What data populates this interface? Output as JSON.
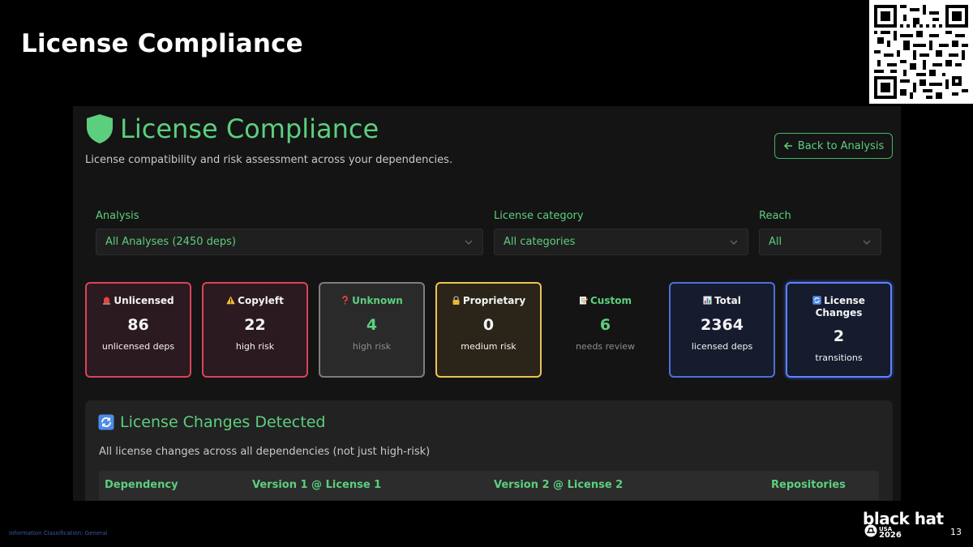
{
  "slide": {
    "title": "License Compliance",
    "classification": "Information Classification: General",
    "page_number": "13",
    "logo_text": "black hat",
    "logo_region": "USA",
    "logo_year": "2026"
  },
  "app": {
    "title": "License Compliance",
    "subtitle": "License compatibility and risk assessment across your dependencies.",
    "back_button": "Back to Analysis",
    "accent_color": "#5ccf7e",
    "filters": {
      "analysis": {
        "label": "Analysis",
        "value": "All Analyses (2450 deps)"
      },
      "category": {
        "label": "License category",
        "value": "All categories"
      },
      "reach": {
        "label": "Reach",
        "value": "All"
      }
    },
    "cards": [
      {
        "icon": "siren-icon",
        "title": "Unlicensed",
        "value": "86",
        "subtitle": "unlicensed deps",
        "color": "#d9445a"
      },
      {
        "icon": "warning-icon",
        "title": "Copyleft",
        "value": "22",
        "subtitle": "high risk",
        "color": "#d9445a"
      },
      {
        "icon": "question-icon",
        "title": "Unknown",
        "value": "4",
        "subtitle": "high risk",
        "color": "#7d7d7d"
      },
      {
        "icon": "lock-icon",
        "title": "Proprietary",
        "value": "0",
        "subtitle": "medium risk",
        "color": "#e9c453"
      },
      {
        "icon": "memo-icon",
        "title": "Custom",
        "value": "6",
        "subtitle": "needs review",
        "color": "#5ccf7e"
      },
      {
        "icon": "bar-chart-icon",
        "title": "Total",
        "value": "2364",
        "subtitle": "licensed deps",
        "color": "#4d6fdc"
      },
      {
        "icon": "refresh-icon",
        "title": "License Changes",
        "value": "2",
        "subtitle": "transitions",
        "color": "#5e84ff"
      }
    ],
    "changes_panel": {
      "title": "License Changes Detected",
      "subtitle": "All license changes across all dependencies (not just high-risk)",
      "columns": [
        "Dependency",
        "Version 1 @ License 1",
        "Version 2 @ License 2",
        "Repositories"
      ]
    }
  }
}
